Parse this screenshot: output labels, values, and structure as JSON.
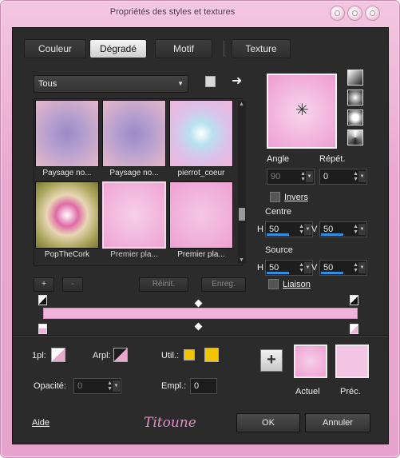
{
  "window": {
    "title": "Propriétés des styles et textures"
  },
  "tabs": [
    {
      "label": "Couleur",
      "active": false
    },
    {
      "label": "Dégradé",
      "active": true
    },
    {
      "label": "Motif",
      "active": false
    },
    {
      "label": "Texture",
      "active": false
    }
  ],
  "library": {
    "category": "Tous",
    "items": [
      {
        "label": "Paysage no..."
      },
      {
        "label": "Paysage no..."
      },
      {
        "label": "pierrot_coeur"
      },
      {
        "label": "PopTheCork"
      },
      {
        "label": "Premier pla...",
        "selected": true
      },
      {
        "label": "Premier pla..."
      }
    ],
    "add_label": "+",
    "remove_label": "-",
    "reset_label": "Réinit.",
    "save_label": "Enreg."
  },
  "gradient": {
    "angle_label": "Angle",
    "angle_value": "90",
    "repeat_label": "Répét.",
    "repeat_value": "0",
    "invert_label": "Invers",
    "center_label": "Centre",
    "center_h_label": "H",
    "center_h": "50",
    "center_v_label": "V",
    "center_v": "50",
    "source_label": "Source",
    "source_h_label": "H",
    "source_h": "50",
    "source_v_label": "V",
    "source_v": "50",
    "link_label": "Liaison"
  },
  "stops": {
    "location_label": "1pl:",
    "arpl_label": "Arpl:",
    "util_label": "Util.:",
    "opacity_label": "Opacité:",
    "opacity_value": "0",
    "empl_label": "Empl.:",
    "empl_value": "0"
  },
  "swatches": {
    "current_label": "Actuel",
    "previous_label": "Préc.",
    "add_label": "+"
  },
  "footer": {
    "help_label": "Aide",
    "signature": "Titoune",
    "ok_label": "OK",
    "cancel_label": "Annuler"
  },
  "colors": {
    "accent_pink": "#f0b4dc",
    "highlight_blue": "#2f8fe5",
    "util_yellow": "#f5c400"
  }
}
